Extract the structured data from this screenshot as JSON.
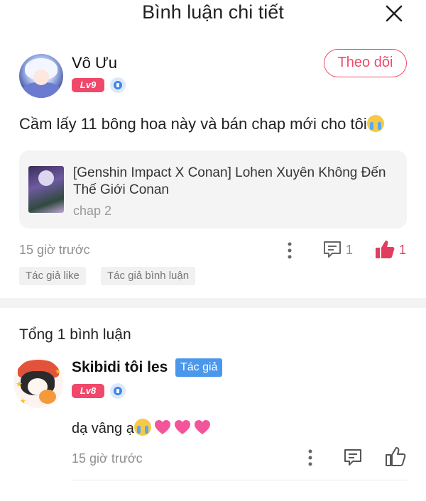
{
  "header": {
    "title": "Bình luận chi tiết",
    "close_icon": "close-icon"
  },
  "post": {
    "author": {
      "name": "Vô Ưu",
      "level": "Lv9",
      "level_color": "#f0486a"
    },
    "follow_label": "Theo dõi",
    "comment": "Cầm lấy 11 bông hoa này và bán chap mới  cho tôi",
    "story": {
      "title": "[Genshin Impact X Conan] Lohen Xuyên Không Đến Thế Giới Conan",
      "chapter": "chap 2"
    },
    "time": "15 giờ trước",
    "comment_count": "1",
    "like_count": "1",
    "tags": [
      "Tác giả like",
      "Tác giả bình luận"
    ],
    "accent_color": "#ef4a6a"
  },
  "replies": {
    "total_label": "Tổng 1 bình luận",
    "items": [
      {
        "name": "Skibidi tôi les",
        "author_badge": "Tác giả",
        "level": "Lv8",
        "text": "dạ vâng ạ",
        "time": "15 giờ trước"
      }
    ]
  },
  "colors": {
    "author_badge": "#4b97ec",
    "liked": "#e23d5e",
    "muted": "#8e8e8e"
  }
}
